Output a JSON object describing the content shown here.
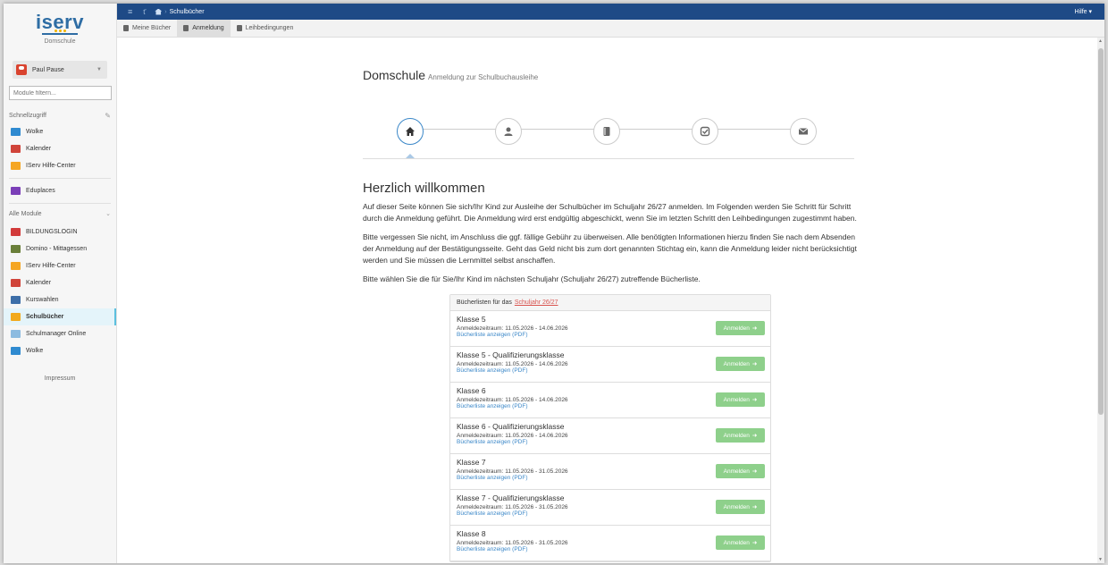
{
  "brand": {
    "logo": "iserv",
    "school": "Domschule"
  },
  "user": {
    "name": "Paul Pause"
  },
  "filter": {
    "placeholder": "Module filtern..."
  },
  "quick": {
    "title": "Schnellzugriff",
    "items": [
      {
        "label": "Wolke",
        "icon": "cloud-icon",
        "color": "#2f8ad0"
      },
      {
        "label": "Kalender",
        "icon": "calendar-icon",
        "color": "#d0443a"
      },
      {
        "label": "IServ Hilfe-Center",
        "icon": "help-center-icon",
        "color": "#f5a623"
      }
    ],
    "extra": {
      "label": "Eduplaces",
      "icon": "eduplaces-icon",
      "color": "#7b3fb8"
    }
  },
  "modules": {
    "title": "Alle Module",
    "items": [
      {
        "label": "BILDUNGSLOGIN",
        "icon": "bildungslogin-icon",
        "color": "#d23a3a",
        "active": false
      },
      {
        "label": "Domino - Mittagessen",
        "icon": "cutlery-icon",
        "color": "#6a7f3a",
        "active": false
      },
      {
        "label": "IServ Hilfe-Center",
        "icon": "help-center-icon",
        "color": "#f5a623",
        "active": false
      },
      {
        "label": "Kalender",
        "icon": "calendar-icon",
        "color": "#d0443a",
        "active": false
      },
      {
        "label": "Kurswahlen",
        "icon": "course-icon",
        "color": "#3d6ea8",
        "active": false
      },
      {
        "label": "Schulbücher",
        "icon": "books-icon",
        "color": "#f2a91c",
        "active": true
      },
      {
        "label": "Schulmanager Online",
        "icon": "school-icon",
        "color": "#8cbbe0",
        "active": false
      },
      {
        "label": "Wolke",
        "icon": "cloud-icon",
        "color": "#2f8ad0",
        "active": false
      }
    ]
  },
  "impressum": "Impressum",
  "topbar": {
    "breadcrumb": "Schulbücher",
    "help": "Hilfe ▾"
  },
  "tabs": [
    {
      "label": "Meine Bücher",
      "icon": "book-icon",
      "active": false
    },
    {
      "label": "Anmeldung",
      "icon": "document-icon",
      "active": true
    },
    {
      "label": "Leihbedingungen",
      "icon": "check-square-icon",
      "active": false
    }
  ],
  "page": {
    "title": "Domschule",
    "subtitle": "Anmeldung zur Schulbuchausleihe"
  },
  "wizard": {
    "steps": [
      {
        "icon": "home-icon",
        "active": true
      },
      {
        "icon": "user-icon",
        "active": false
      },
      {
        "icon": "book-icon",
        "active": false
      },
      {
        "icon": "check-icon",
        "active": false
      },
      {
        "icon": "envelope-icon",
        "active": false
      }
    ]
  },
  "welcome": {
    "heading": "Herzlich willkommen",
    "p1": "Auf dieser Seite können Sie sich/Ihr Kind zur Ausleihe der Schulbücher im Schuljahr 26/27 anmelden. Im Folgenden werden Sie Schritt für Schritt durch die Anmeldung geführt. Die Anmeldung wird erst endgültig abgeschickt, wenn Sie im letzten Schritt den Leihbedingungen zugestimmt haben.",
    "p2": "Bitte vergessen Sie nicht, im Anschluss die ggf. fällige Gebühr zu überweisen. Alle benötigten Informationen hierzu finden Sie nach dem Absenden der Anmeldung auf der Bestätigungsseite. Geht das Geld nicht bis zum dort genannten Stichtag ein, kann die Anmeldung leider nicht berücksichtigt werden und Sie müssen die Lernmittel selbst anschaffen.",
    "p3": "Bitte wählen Sie die für Sie/Ihr Kind im nächsten Schuljahr (Schuljahr 26/27) zutreffende Bücherliste."
  },
  "booklists": {
    "header": "Bücherlisten für das",
    "year_link": "Schuljahr 26/27",
    "button": "Anmelden",
    "pdf_label": "Bücherliste anzeigen (PDF)",
    "rows": [
      {
        "name": "Klasse 5",
        "period": "Anmeldezeitraum: 11.05.2026 - 14.06.2026"
      },
      {
        "name": "Klasse 5 - Qualifizierungsklasse",
        "period": "Anmeldezeitraum: 11.05.2026 - 14.06.2026"
      },
      {
        "name": "Klasse 6",
        "period": "Anmeldezeitraum: 11.05.2026 - 14.06.2026"
      },
      {
        "name": "Klasse 6 - Qualifizierungsklasse",
        "period": "Anmeldezeitraum: 11.05.2026 - 14.06.2026"
      },
      {
        "name": "Klasse 7",
        "period": "Anmeldezeitraum: 11.05.2026 - 31.05.2026"
      },
      {
        "name": "Klasse 7 - Qualifizierungsklasse",
        "period": "Anmeldezeitraum: 11.05.2026 - 31.05.2026"
      },
      {
        "name": "Klasse 8",
        "period": "Anmeldezeitraum: 11.05.2026 - 31.05.2026"
      }
    ]
  }
}
